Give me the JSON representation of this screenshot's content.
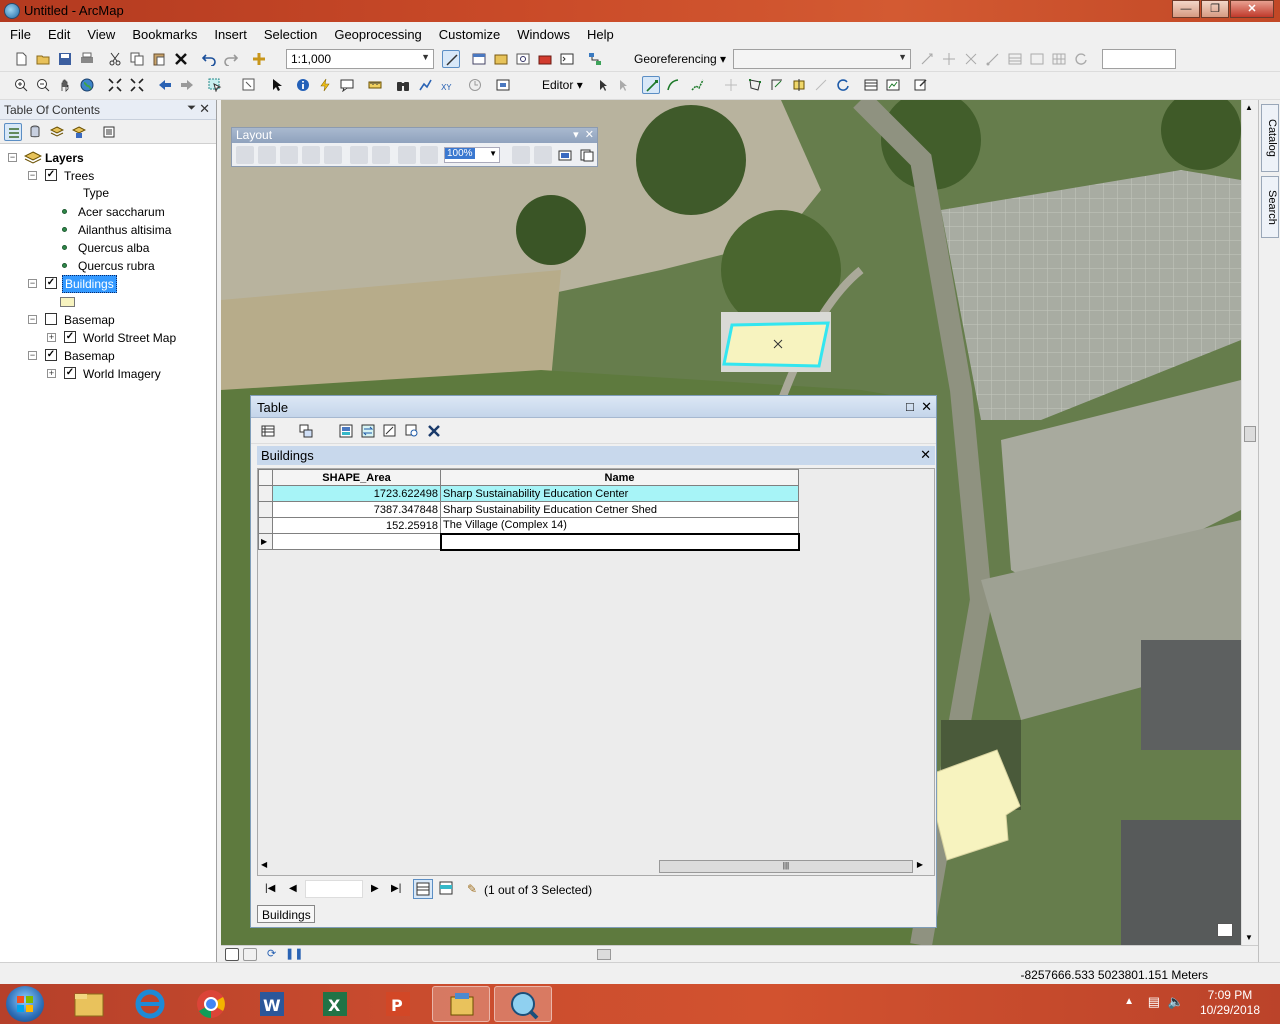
{
  "window": {
    "title": "Untitled - ArcMap"
  },
  "menu": [
    "File",
    "Edit",
    "View",
    "Bookmarks",
    "Insert",
    "Selection",
    "Geoprocessing",
    "Customize",
    "Windows",
    "Help"
  ],
  "toolbar": {
    "scale_value": "1:1,000",
    "georeferencing_label": "Georeferencing",
    "georef_layer_value": "",
    "georef_input_value": "",
    "editor_label": "Editor"
  },
  "toc": {
    "title": "Table Of Contents",
    "layers_label": "Layers",
    "trees_label": "Trees",
    "type_label": "Type",
    "species": [
      "Acer saccharum",
      "Ailanthus altisima",
      "Quercus alba",
      "Quercus rubra"
    ],
    "buildings_label": "Buildings",
    "basemap1_label": "Basemap",
    "world_street_map_label": "World Street Map",
    "basemap2_label": "Basemap",
    "world_imagery_label": "World Imagery"
  },
  "layout_toolbar": {
    "title": "Layout",
    "zoom_value": "100%"
  },
  "table_window": {
    "title": "Table",
    "tab_title": "Buildings",
    "columns": [
      "SHAPE_Area",
      "Name"
    ],
    "rows": [
      {
        "area": "1723.622498",
        "name": "Sharp Sustainability Education Center",
        "selected": true
      },
      {
        "area": "7387.347848",
        "name": "Sharp Sustainability Education Cetner Shed",
        "selected": false
      },
      {
        "area": "152.25918",
        "name": "The Village (Complex 14)",
        "selected": false
      }
    ],
    "selection_status": "(1 out of 3 Selected)",
    "bottom_tab": "Buildings"
  },
  "dock": {
    "catalog": "Catalog",
    "search": "Search"
  },
  "status": {
    "coords": "-8257666.533  5023801.151 Meters"
  },
  "clock": {
    "time": "7:09 PM",
    "date": "10/29/2018"
  },
  "colors": {
    "selection_highlight": "#a7f4f7",
    "building_fill": "#f7f3bf",
    "selected_outline": "#33e6f0"
  }
}
